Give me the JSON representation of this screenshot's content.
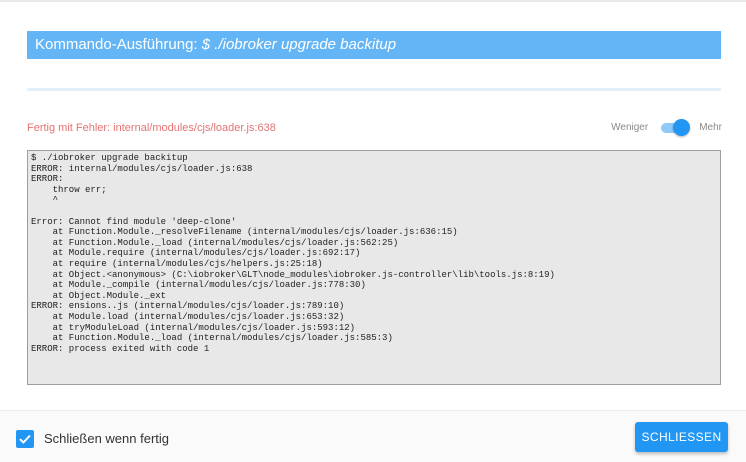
{
  "dialog": {
    "title_prefix": "Kommando-Ausführung: ",
    "title_command": "$ ./iobroker upgrade backitup",
    "error_text": "Fertig mit Fehler: internal/modules/cjs/loader.js:638",
    "toggle": {
      "less_label": "Weniger",
      "more_label": "Mehr",
      "state": "more"
    },
    "log_lines": [
      "$ ./iobroker upgrade backitup",
      "ERROR: internal/modules/cjs/loader.js:638",
      "ERROR:",
      "    throw err;",
      "    ^",
      "",
      "Error: Cannot find module 'deep-clone'",
      "    at Function.Module._resolveFilename (internal/modules/cjs/loader.js:636:15)",
      "    at Function.Module._load (internal/modules/cjs/loader.js:562:25)",
      "    at Module.require (internal/modules/cjs/loader.js:692:17)",
      "    at require (internal/modules/cjs/helpers.js:25:18)",
      "    at Object.<anonymous> (C:\\iobroker\\GLT\\node_modules\\iobroker.js-controller\\lib\\tools.js:8:19)",
      "    at Module._compile (internal/modules/cjs/loader.js:778:30)",
      "    at Object.Module._ext",
      "ERROR: ensions..js (internal/modules/cjs/loader.js:789:10)",
      "    at Module.load (internal/modules/cjs/loader.js:653:32)",
      "    at tryModuleLoad (internal/modules/cjs/loader.js:593:12)",
      "    at Function.Module._load (internal/modules/cjs/loader.js:585:3)",
      "ERROR: process exited with code 1"
    ],
    "footer": {
      "close_when_done_label": "Schließen wenn fertig",
      "close_when_done_checked": true,
      "close_button_label": "SCHLIESSEN"
    },
    "colors": {
      "title_bg": "#64b5f6",
      "accent": "#2196f3",
      "error_text": "#e57373",
      "log_bg": "#e8e8e8"
    },
    "icons": {
      "checkbox": "check-icon"
    }
  }
}
